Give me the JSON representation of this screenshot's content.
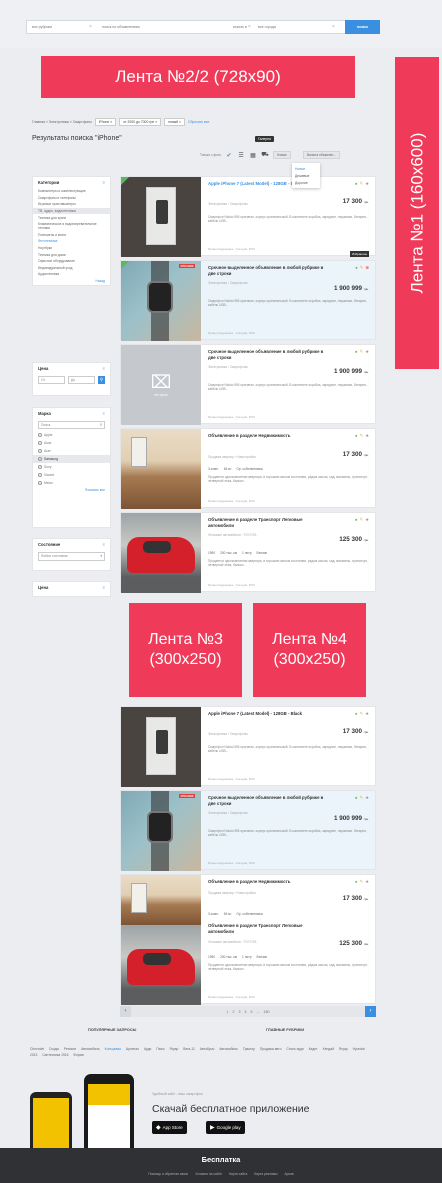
{
  "search": {
    "category": "все рубрики",
    "query_placeholder": "поиск по объявлениям",
    "city_label": "искать в",
    "city": "все города",
    "button": "поиск"
  },
  "ads": {
    "top": "Лента №2/2 (728x90)",
    "side": "Лента №1 (160x600)",
    "mid_left": "Лента №3 (300x250)",
    "mid_right": "Лента №4 (300x250)"
  },
  "breadcrumb": {
    "path": "Главная » Электроника » Смартфоны",
    "filter_model": "iPhone ×",
    "filter_price": "от 2000 до 7000 грн ×",
    "filter_state": "новый ×",
    "reset": "Сбросить все"
  },
  "page_title": "Результаты поиска \"iPhone\"",
  "view": {
    "tooltip": "Галерея",
    "photo_only": "Только с фото",
    "sort": "Новые",
    "currency": "Валюта объявлен...",
    "sort_options": [
      "Новые",
      "Дешевые",
      "Дорогие"
    ]
  },
  "sidebar": {
    "categories_title": "Категории",
    "categories": [
      "Компьютеры и комплектующие",
      "Смартфоны и телефоны",
      "Игровые приставки/игры",
      "ТВ, аудио, видеотехника",
      "Техника для кухни",
      "Климатическое и водонагревательное техника",
      "Планшеты и книги",
      "Фототехника",
      "Ноутбуки",
      "Техника для дома",
      "Офисное оборудование",
      "Индивидуальный уход",
      "Аудиотехника"
    ],
    "categories_more": "Назад",
    "price_title": "Цена",
    "price_from": "От",
    "price_to": "До",
    "brand_title": "Марка",
    "brand_search": "Поиск",
    "brands": [
      "Apple",
      "Asus",
      "Acer",
      "Samsung",
      "Sony",
      "Xiaomi",
      "Meizu"
    ],
    "brands_more": "Показать все",
    "state_title": "Состояние",
    "state_value": "Любое состояние",
    "price2_title": "Цена"
  },
  "listings": [
    {
      "title": "Apple iPhone 7 (Latest Model) - 128GB - Black",
      "category": "Электроника › Смартфоны",
      "price": "17 300",
      "currency": "грн.",
      "desc": "Смартфон Nokia N95 оригинал, корпус оригинальный. В комплекте коробка, зарядное, наушники, батарея, кабель USB...",
      "meta": "Ирина Андреевна · Сегодня, 8:53"
    },
    {
      "badge": "СРОЧНОЕ",
      "title": "Срочное выделенное объявление в любой рубрике в две строки",
      "category": "Электроника › Смартфоны",
      "price": "1 900 999",
      "currency": "грн.",
      "desc": "Смартфон Nokia N95 оригинал, корпус оригинальный. В комплекте коробка, зарядное, наушники, батарея, кабель USB...",
      "meta": "Ирина Андреевна · Сегодня, 8:53"
    },
    {
      "no_photo": "нет фото",
      "title": "Срочное выделенное объявление в любой рубрике в две строки",
      "category": "Электроника › Смартфоны",
      "price": "1 900 999",
      "currency": "грн.",
      "desc": "Смартфон Nokia N95 оригинал, корпус оригинальный. В комплекте коробка, зарядное, наушники, батарея, кабель USB...",
      "meta": "Ирина Андреевна · Сегодня, 8:53"
    },
    {
      "title": "Объявление в рaзделе Недвижимость",
      "category": "Продажа квартир › Новостройки",
      "price": "17 300",
      "currency": "грн.",
      "attrs": [
        "3 комн.",
        "54 м²",
        "Ор. собственника"
      ],
      "desc": "Продается однокомнатная квартира, в хорошем жилом состоянии, рядом школа, сад, магазины, транспорт, четвертый этаж, балкон...",
      "meta": "Ирина Андреевна · Сегодня, 8:53"
    },
    {
      "title": "Объявление в рaзделе Транспорт Легковые автомобили",
      "category": "Легковые автомобили › TOYOTA",
      "price": "125 300",
      "currency": "грн.",
      "attrs": [
        "1990",
        "200 тыс. км",
        "1 литр",
        "Бензин"
      ],
      "desc": "Продается однокомнатная квартира, в хорошем жилом состоянии, рядом школа, сад, магазины, транспорт, четвертый этаж, балкон...",
      "meta": "Ирина Андреевна · Сегодня, 8:53"
    }
  ],
  "tip_favorite": "Избранное",
  "pager": {
    "pages": [
      "1",
      "2",
      "3",
      "4",
      "5"
    ],
    "ellipsis": "...",
    "last": "180"
  },
  "footer": {
    "popular_title": "ПОПУЛЯРНЫЕ ЗАПРОСЫ",
    "rubrics_title": "ГЛАВНЫЕ РУБРИКИ",
    "links": [
      "Chevrolet",
      "Скоды",
      "Ретикон",
      "Автомобиль",
      "Кольцевая",
      "Арсенал",
      "Ауди",
      "Пежо",
      "Ягуар",
      "Вега-11",
      "Автобусы",
      "Автомобиль",
      "Трактор",
      "Продажа авто",
      "Сталь ауди",
      "Кадет",
      "Хендай",
      "Ягуар",
      "Hyundai 2013",
      "Сантехника 1916",
      "Форма"
    ],
    "app_subtitle": "Удобный сайт - ваш смартфон",
    "app_title": "Скачай бесплатное приложение",
    "app_store": "App Store",
    "google_play": "Google play",
    "brand": "Бесплатка",
    "bottom_links": [
      "Помощь и обратная связь",
      "Условия на сайте",
      "Карта сайта",
      "Карта рекламы",
      "Архив"
    ]
  },
  "colors": {
    "accent": "#3b8fe0",
    "ad": "#ef3b59",
    "footer": "#2f3134"
  }
}
